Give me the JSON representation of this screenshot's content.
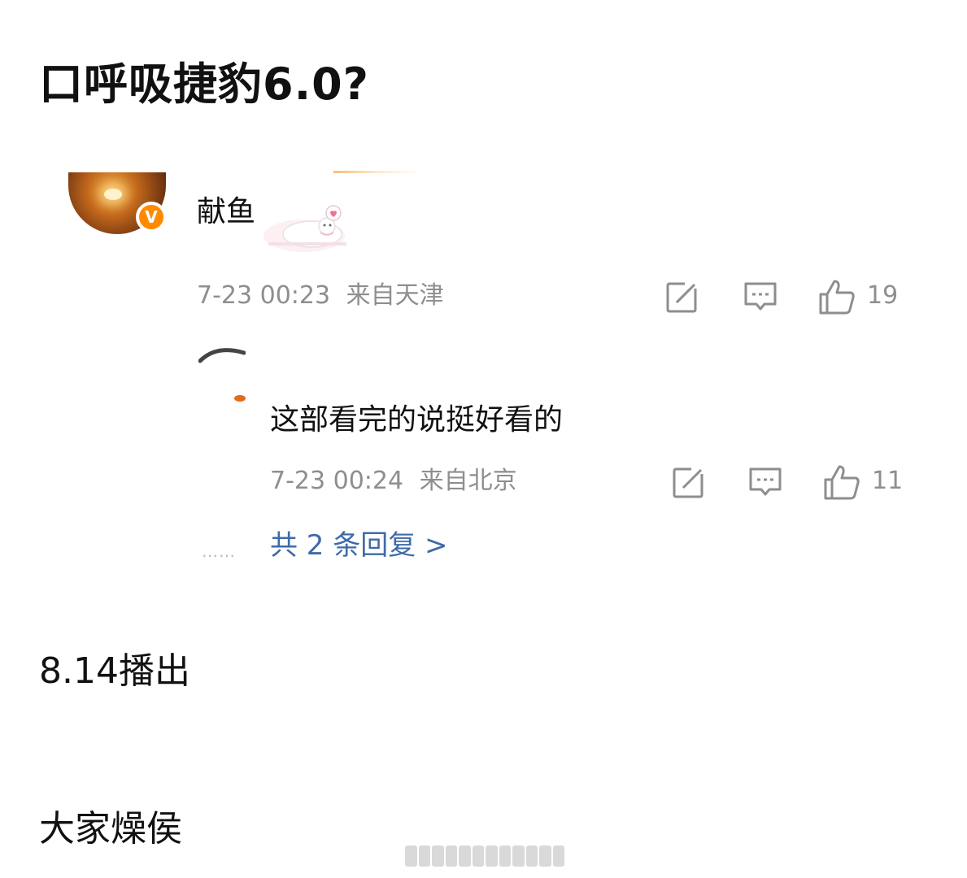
{
  "post": {
    "title": "口呼吸捷豹6.0?",
    "lines": [
      "8.14播出",
      "大家燥侯"
    ]
  },
  "comment": {
    "verified_badge": "V",
    "text": "献鱼",
    "sticker": "cat-sticker",
    "time": "7-23 00:23",
    "location": "来自天津",
    "likes": "19"
  },
  "reply": {
    "text": "这部看完的说挺好看的",
    "time": "7-23 00:24",
    "location": "来自北京",
    "likes": "11"
  },
  "more_replies": {
    "dots": "……",
    "label": "共 2 条回复 >"
  },
  "colors": {
    "meta_gray": "#8e8e8e",
    "link_blue": "#3f6aa8",
    "badge_orange": "#ff8a00"
  },
  "icons": [
    "share-icon",
    "comment-icon",
    "like-icon"
  ]
}
